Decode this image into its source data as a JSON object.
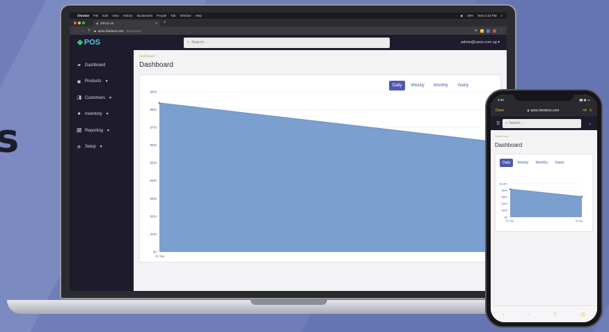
{
  "background_text": "s",
  "mac_menubar": {
    "items": [
      "Chrome",
      "File",
      "Edit",
      "View",
      "History",
      "Bookmarks",
      "People",
      "Tab",
      "Window",
      "Help"
    ],
    "battery": "49%",
    "datetime": "Wed 3:33 PM"
  },
  "browser": {
    "tab_title": "EPOS v6",
    "url_host": "epos.livedevs.com",
    "url_path": "/dashboard"
  },
  "app": {
    "logo_text": "POS",
    "search_placeholder": "Search...",
    "user": "admin@epos.com.sg",
    "sidebar": [
      {
        "label": "Dashboard",
        "icon": "dashboard-icon"
      },
      {
        "label": "Products",
        "icon": "box-icon"
      },
      {
        "label": "Customers",
        "icon": "users-icon"
      },
      {
        "label": "Inventory",
        "icon": "inventory-icon"
      },
      {
        "label": "Reporting",
        "icon": "chart-icon"
      },
      {
        "label": "Setup",
        "icon": "gear-icon"
      }
    ],
    "breadcrumb": "Dashboard",
    "page_title": "Dashboard",
    "range_tabs": [
      "Daily",
      "Weekly",
      "Monthly",
      "Yearly"
    ],
    "active_range": "Daily"
  },
  "phone": {
    "time": "3:34",
    "done_label": "Done",
    "url": "epos.livedevs.com",
    "search_placeholder": "Search...",
    "breadcrumb": "Dashboard",
    "page_title": "Dashboard",
    "range_tabs": [
      "Daily",
      "Weekly",
      "Monthly",
      "Yearly"
    ],
    "active_range": "Daily"
  },
  "colors": {
    "accent": "#4d5aaf",
    "chart_fill": "#7b9fcf",
    "sidebar_bg": "#1e1c2c",
    "breadcrumb_green": "#8bc34a"
  },
  "chart_data": [
    {
      "type": "area",
      "x": [
        "01 Sep",
        "30 Sep"
      ],
      "values": [
        838,
        615
      ],
      "yticks": [
        "$0",
        "$100",
        "$200",
        "$300",
        "$400",
        "$500",
        "$600",
        "$700",
        "$800",
        "$900"
      ],
      "ylim": [
        0,
        900
      ],
      "grid": true
    },
    {
      "type": "area",
      "x": [
        "01 Sep",
        "30 Sep"
      ],
      "values": [
        838,
        615
      ],
      "yticks": [
        "$0",
        "$200",
        "$400",
        "$600",
        "$800",
        "$1,000"
      ],
      "ylim": [
        0,
        1000
      ],
      "grid": true
    }
  ]
}
